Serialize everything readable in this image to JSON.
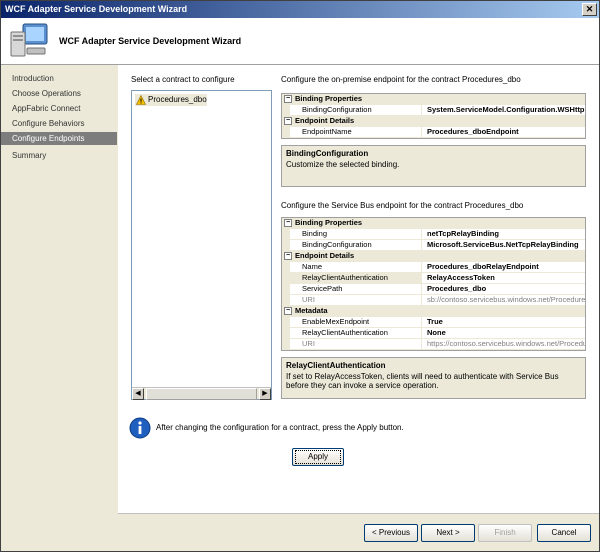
{
  "window": {
    "title": "WCF Adapter Service Development Wizard"
  },
  "header": {
    "title": "WCF Adapter Service Development Wizard",
    "icon": "computer-icon"
  },
  "nav": {
    "items": [
      {
        "label": "Introduction",
        "selected": false
      },
      {
        "label": "Choose Operations",
        "selected": false
      },
      {
        "label": "AppFabric Connect",
        "selected": false
      },
      {
        "label": "Configure Behaviors",
        "selected": false
      },
      {
        "label": "Configure Endpoints",
        "selected": true
      },
      {
        "label": "Summary",
        "selected": false
      }
    ]
  },
  "contracts": {
    "label": "Select a contract to configure",
    "items": [
      "Procedures_dbo"
    ]
  },
  "onpremise": {
    "label": "Configure the on-premise endpoint for the contract Procedures_dbo",
    "categories": [
      {
        "name": "Binding Properties",
        "rows": [
          {
            "name": "BindingConfiguration",
            "value": "System.ServiceModel.Configuration.WSHttpB"
          }
        ]
      },
      {
        "name": "Endpoint Details",
        "rows": [
          {
            "name": "EndpointName",
            "value": "Procedures_dboEndpoint"
          }
        ]
      }
    ],
    "desc_title": "BindingConfiguration",
    "desc_text": "Customize the selected binding."
  },
  "servicebus": {
    "label": "Configure the Service Bus endpoint for the contract Procedures_dbo",
    "categories": [
      {
        "name": "Binding Properties",
        "rows": [
          {
            "name": "Binding",
            "value": "netTcpRelayBinding"
          },
          {
            "name": "BindingConfiguration",
            "value": "Microsoft.ServiceBus.NetTcpRelayBinding"
          }
        ]
      },
      {
        "name": "Endpoint Details",
        "rows": [
          {
            "name": "Name",
            "value": "Procedures_dboRelayEndpoint"
          },
          {
            "name": "RelayClientAuthentication",
            "value": "RelayAccessToken"
          },
          {
            "name": "ServicePath",
            "value": "Procedures_dbo"
          },
          {
            "name": "URI",
            "value": "sb://contoso.servicebus.windows.net/Procedure"
          }
        ]
      },
      {
        "name": "Metadata",
        "rows": [
          {
            "name": "EnableMexEndpoint",
            "value": "True"
          },
          {
            "name": "RelayClientAuthentication",
            "value": "None"
          },
          {
            "name": "URI",
            "value": "https://contoso.servicebus.windows.net/Procedu"
          }
        ]
      }
    ],
    "desc_title": "RelayClientAuthentication",
    "desc_text": "If set to RelayAccessToken, clients will need to authenticate with Service Bus before they can invoke a service operation."
  },
  "info": {
    "text": "After changing the configuration for a contract, press the Apply button."
  },
  "buttons": {
    "apply": "Apply",
    "previous": "< Previous",
    "next": "Next >",
    "finish": "Finish",
    "cancel": "Cancel"
  }
}
